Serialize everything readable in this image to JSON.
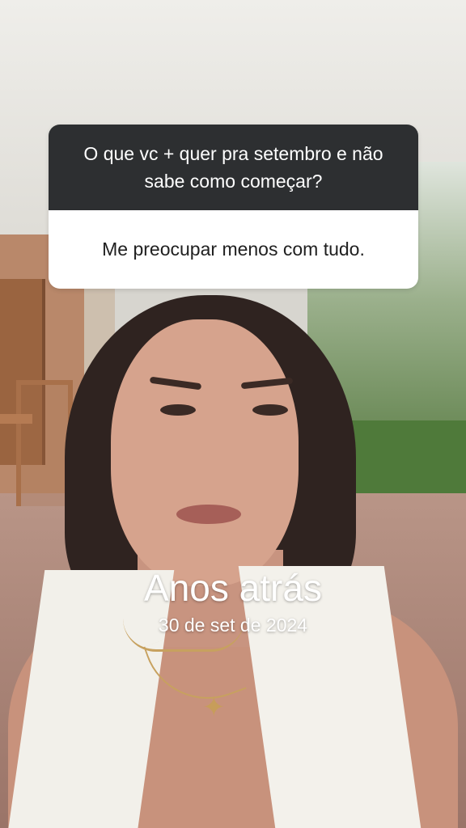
{
  "question_card": {
    "question": "O que vc + quer pra setembro e não sabe como começar?",
    "answer": "Me preocupar menos com tudo."
  },
  "memory": {
    "title": "Anos atrás",
    "date": "30 de set de 2024"
  },
  "colors": {
    "question_bg": "#2d2f31",
    "answer_bg": "#ffffff",
    "overlay_text": "#ffffff"
  }
}
